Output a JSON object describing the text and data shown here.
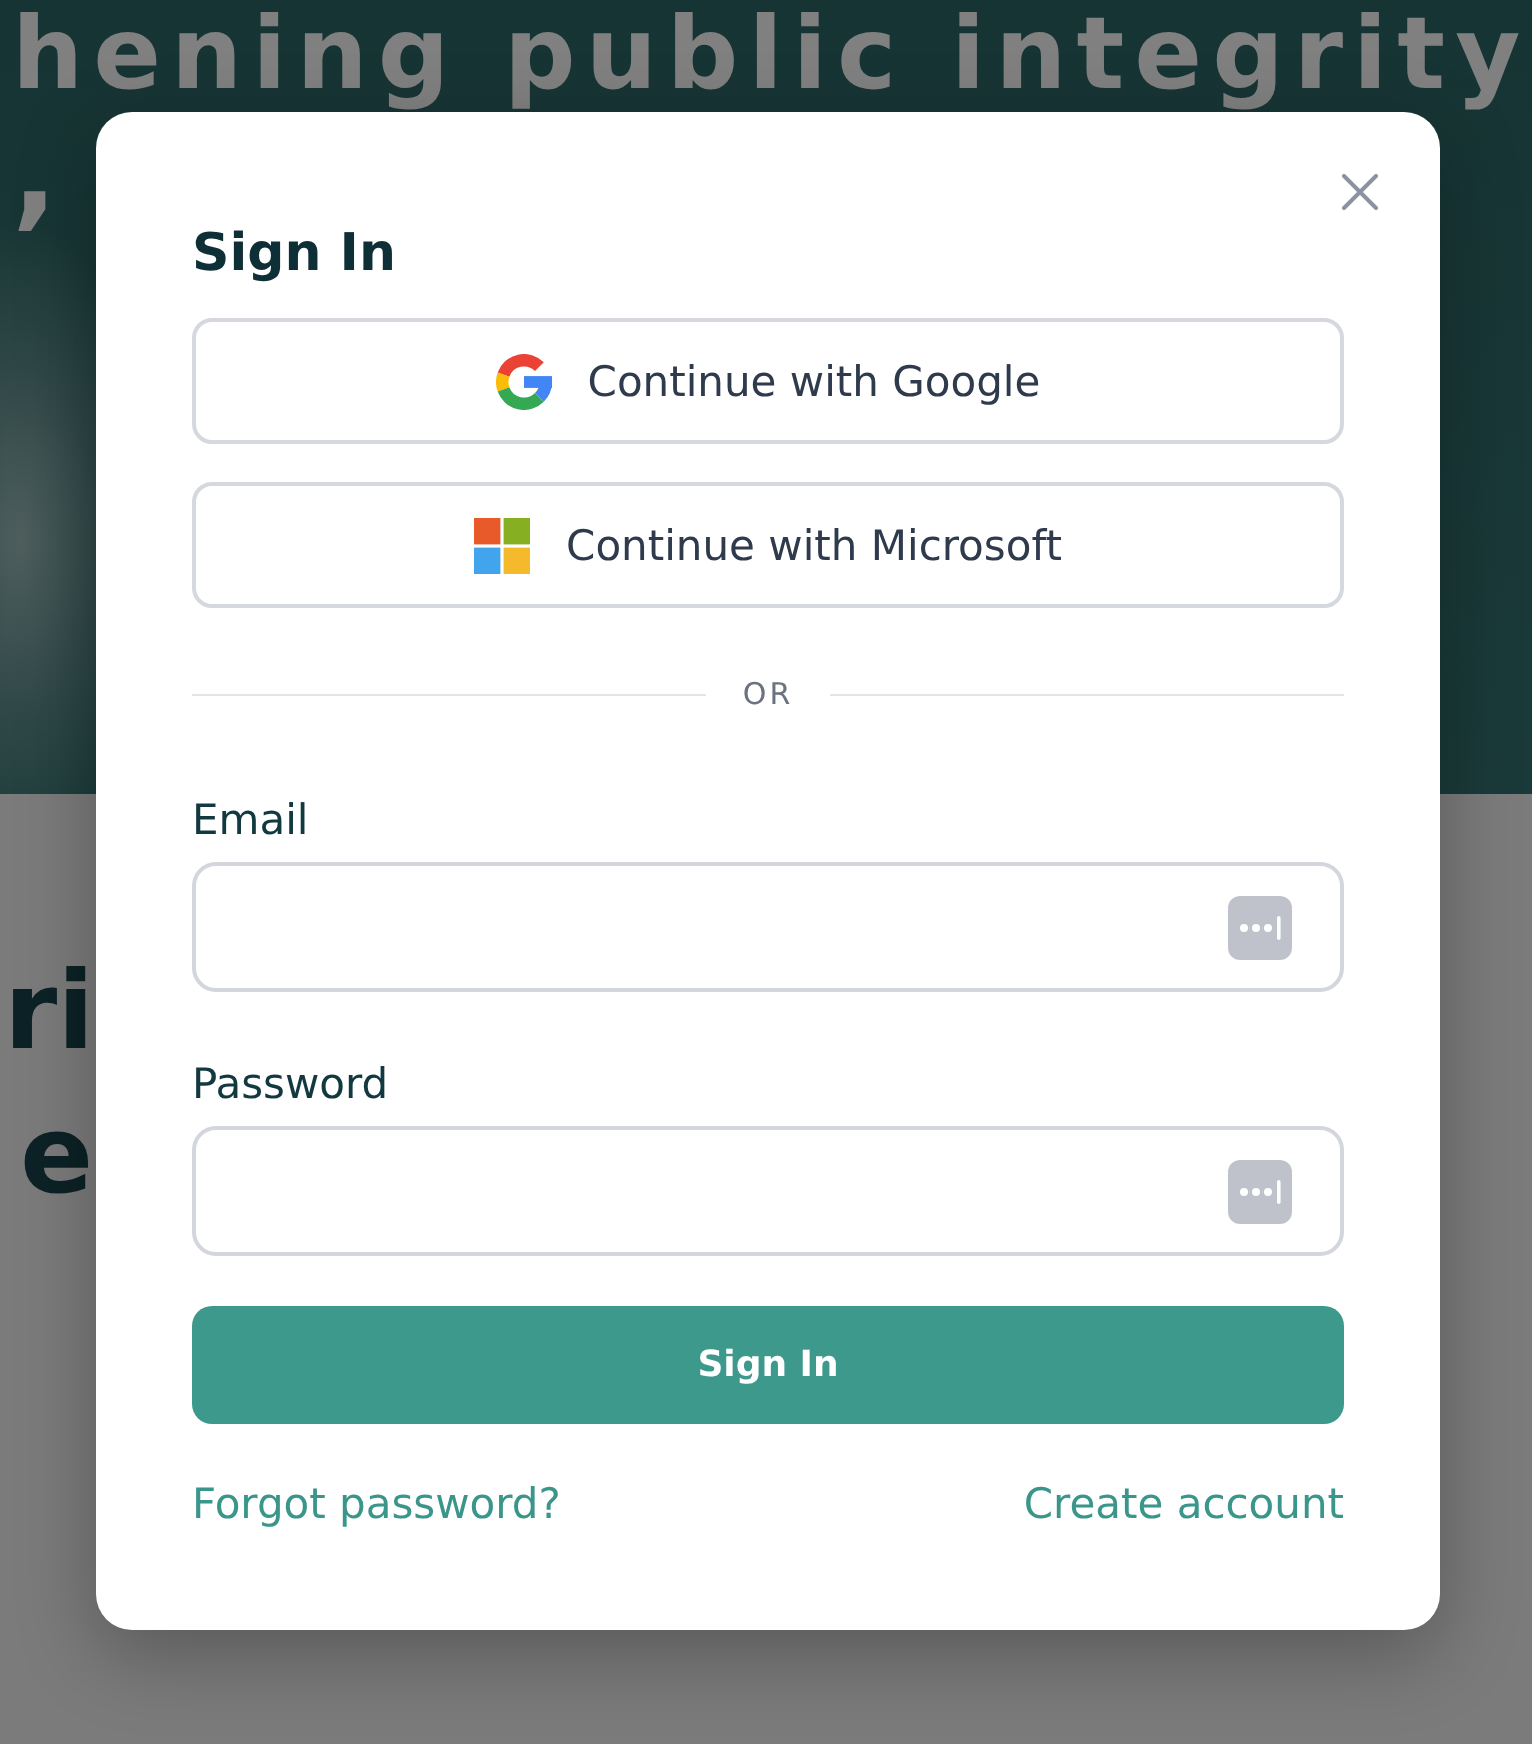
{
  "background": {
    "hero_heading": {
      "line_1": "hening public integrity",
      "line_2": ","
    },
    "section_heading": {
      "line_1": "ri",
      "line_2": "e"
    }
  },
  "dialog": {
    "title": "Sign In",
    "providers": [
      {
        "kind": "google",
        "label": "Continue with Google"
      },
      {
        "kind": "microsoft",
        "label": "Continue with Microsoft"
      }
    ],
    "divider": "OR",
    "email": {
      "label": "Email"
    },
    "password": {
      "label": "Password"
    },
    "submit": "Sign In",
    "forgot_password_link": "Forgot password?",
    "create_account_link": "Create account"
  }
}
